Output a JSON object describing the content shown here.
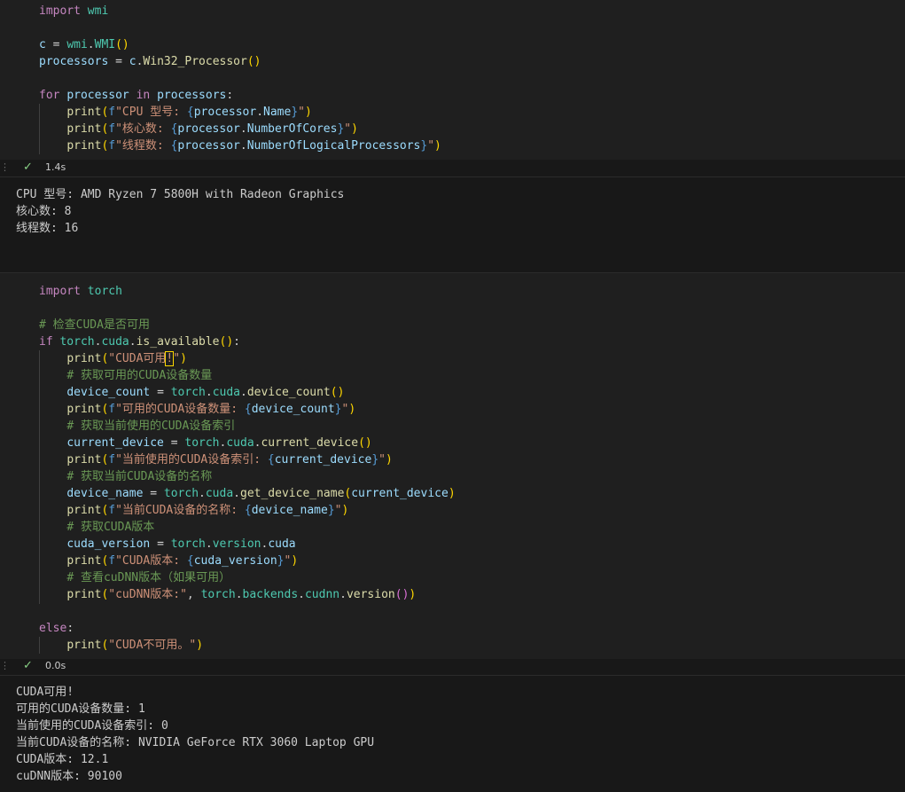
{
  "cell1": {
    "code": [
      "import wmi",
      "",
      "c = wmi.WMI()",
      "processors = c.Win32_Processor()",
      "",
      "for processor in processors:",
      "    print(f\"CPU 型号: {processor.Name}\")",
      "    print(f\"核心数: {processor.NumberOfCores}\")",
      "    print(f\"线程数: {processor.NumberOfLogicalProcessors}\")"
    ],
    "status_time": "1.4s",
    "output": [
      "CPU 型号: AMD Ryzen 7 5800H with Radeon Graphics",
      "核心数: 8",
      "线程数: 16"
    ]
  },
  "cell2": {
    "code": [
      "import torch",
      "",
      "# 检查CUDA是否可用",
      "if torch.cuda.is_available():",
      "    print(\"CUDA可用!\")",
      "    # 获取可用的CUDA设备数量",
      "    device_count = torch.cuda.device_count()",
      "    print(f\"可用的CUDA设备数量: {device_count}\")",
      "    # 获取当前使用的CUDA设备索引",
      "    current_device = torch.cuda.current_device()",
      "    print(f\"当前使用的CUDA设备索引: {current_device}\")",
      "    # 获取当前CUDA设备的名称",
      "    device_name = torch.cuda.get_device_name(current_device)",
      "    print(f\"当前CUDA设备的名称: {device_name}\")",
      "    # 获取CUDA版本",
      "    cuda_version = torch.version.cuda",
      "    print(f\"CUDA版本: {cuda_version}\")",
      "    # 查看cuDNN版本（如果可用）",
      "    print(\"cuDNN版本:\", torch.backends.cudnn.version())",
      "",
      "else:",
      "    print(\"CUDA不可用。\")"
    ],
    "status_time": "0.0s",
    "output": [
      "CUDA可用!",
      "可用的CUDA设备数量: 1",
      "当前使用的CUDA设备索引: 0",
      "当前CUDA设备的名称: NVIDIA GeForce RTX 3060 Laptop GPU",
      "CUDA版本: 12.1",
      "cuDNN版本: 90100"
    ]
  },
  "colors": {
    "editor_bg": "#1f1f1f",
    "output_bg": "#181818",
    "success_check": "#89d185",
    "keyword": "#c586c0",
    "string": "#ce9178",
    "comment": "#6a9955",
    "function": "#dcdcaa",
    "variable": "#9cdcfe",
    "module": "#4ec9b0"
  },
  "icons": {
    "status_success": "check-icon"
  }
}
